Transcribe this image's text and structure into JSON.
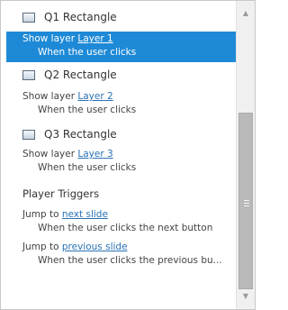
{
  "objects": [
    {
      "title": "Q1 Rectangle",
      "icon": "rectangle-icon",
      "trigger": {
        "action": "Show layer",
        "target": "Layer 1",
        "condition": "When the user clicks",
        "selected": true
      }
    },
    {
      "title": "Q2 Rectangle",
      "icon": "rectangle-icon",
      "trigger": {
        "action": "Show layer",
        "target": "Layer 2",
        "condition": "When the user clicks",
        "selected": false
      }
    },
    {
      "title": "Q3 Rectangle",
      "icon": "rectangle-icon",
      "trigger": {
        "action": "Show layer",
        "target": "Layer 3",
        "condition": "When the user clicks",
        "selected": false
      }
    }
  ],
  "player_triggers": {
    "title": "Player Triggers",
    "items": [
      {
        "action": "Jump to",
        "target": "next slide",
        "condition": "When the user clicks the next button"
      },
      {
        "action": "Jump to",
        "target": "previous slide",
        "condition": "When the user clicks the previous bu..."
      }
    ]
  },
  "colors": {
    "selection": "#1e8ad7",
    "link": "#2a72b5"
  },
  "scrollbar": {
    "up_icon": "scroll-up-arrow-icon",
    "down_icon": "scroll-down-arrow-icon"
  }
}
